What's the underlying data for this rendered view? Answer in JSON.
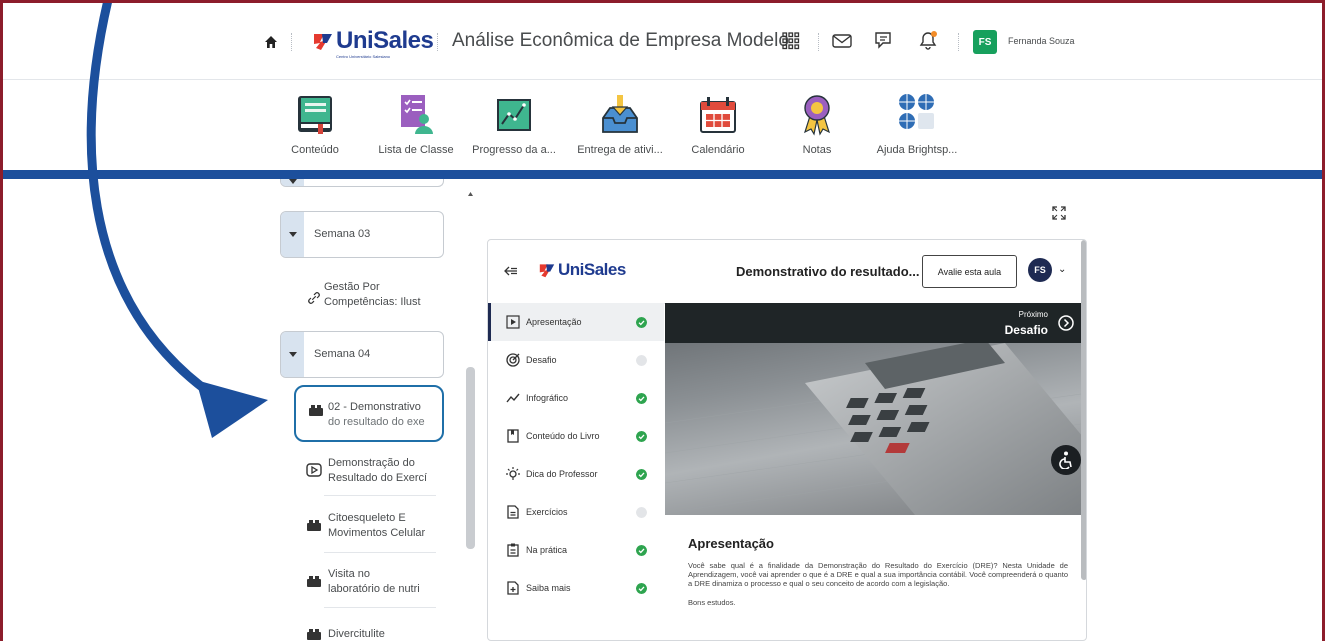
{
  "topbar": {
    "brand": "UniSales",
    "brand_sub": "Centro Universitário Salesiano",
    "course_title": "Análise Econômica de Empresa Modelo",
    "user_initials": "FS",
    "user_name": "Fernanda Souza",
    "icons": [
      "home-icon",
      "apps-grid-icon",
      "mail-icon",
      "chat-icon",
      "bell-icon"
    ]
  },
  "navbar": {
    "items": [
      {
        "label": "Conteúdo",
        "icon": "book-icon"
      },
      {
        "label": "Lista de Classe",
        "icon": "class-list-icon"
      },
      {
        "label": "Progresso da a...",
        "icon": "progress-chart-icon"
      },
      {
        "label": "Entrega de ativi...",
        "icon": "dropbox-icon"
      },
      {
        "label": "Calendário",
        "icon": "calendar-icon"
      },
      {
        "label": "Notas",
        "icon": "award-icon"
      },
      {
        "label": "Ajuda Brightsp...",
        "icon": "help-globe-icon"
      }
    ]
  },
  "sidebar": {
    "weeks": [
      "Semana 03",
      "Semana 04"
    ],
    "items": [
      {
        "line1": "Gestão Por",
        "line2": "Competências: Ilust",
        "icon": "link-icon"
      },
      {
        "line1": "02 - Demonstrativo",
        "line2": "do resultado do exe",
        "icon": "lego-icon",
        "selected": true
      },
      {
        "line1": "Demonstração do",
        "line2": "Resultado do Exercí",
        "icon": "video-icon"
      },
      {
        "line1": "Citoesqueleto E",
        "line2": "Movimentos Celular",
        "icon": "lego-icon"
      },
      {
        "line1": "Visita no",
        "line2": "laboratório de nutri",
        "icon": "lego-icon"
      },
      {
        "line1": "Divercitulite",
        "line2": "",
        "icon": "lego-icon"
      }
    ]
  },
  "player": {
    "brand": "UniSales",
    "title": "Demonstrativo do resultado...",
    "rate_button": "Avalie esta aula",
    "avatar": "FS",
    "menu": [
      {
        "label": "Apresentação",
        "icon": "play-box-icon",
        "done": true
      },
      {
        "label": "Desafio",
        "icon": "target-icon",
        "done": false
      },
      {
        "label": "Infográfico",
        "icon": "trend-icon",
        "done": true
      },
      {
        "label": "Conteúdo do Livro",
        "icon": "bookmark-icon",
        "done": true
      },
      {
        "label": "Dica do Professor",
        "icon": "bulb-icon",
        "done": true
      },
      {
        "label": "Exercícios",
        "icon": "document-icon",
        "done": false
      },
      {
        "label": "Na prática",
        "icon": "clipboard-icon",
        "done": true
      },
      {
        "label": "Saiba mais",
        "icon": "file-plus-icon",
        "done": true
      }
    ],
    "next_label": "Próximo",
    "next_target": "Desafio",
    "section_title": "Apresentação",
    "paragraph": "Você sabe qual é a finalidade da Demonstração do Resultado do Exercício (DRE)? Nesta Unidade de Aprendizagem, você vai aprender o que é a DRE e qual a sua importância contábil. Você compreenderá o quanto a DRE dinamiza o processo e qual o seu conceito de acordo com a legislação.",
    "closing": "Bons estudos."
  },
  "colors": {
    "accent_red": "#8c1d2b",
    "accent_blue": "#1c4f9c",
    "done_green": "#2ea44f",
    "pending_gray": "#e3e5e8",
    "avatar_green": "#17a05d"
  }
}
